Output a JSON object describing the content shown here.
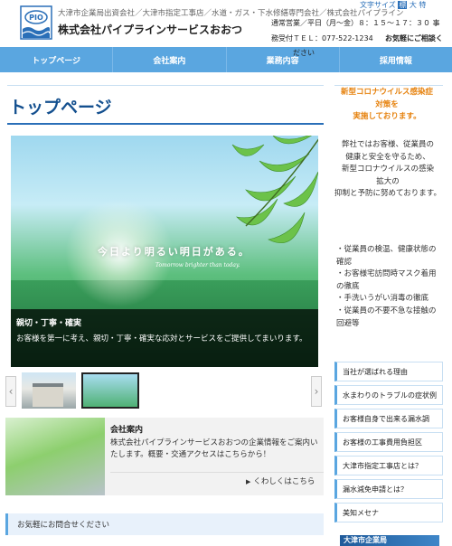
{
  "header": {
    "tagline": "大津市企業局出資会社／大津市指定工事店／水道・ガス・下水修繕専門会社／株式会社パイプライン",
    "company_name": "株式会社パイプラインサービスおおつ",
    "logo_text": "PIO",
    "font_size": {
      "label": "文字サイズ",
      "options": [
        "標",
        "大",
        "特"
      ],
      "selected": "標"
    },
    "hours_line1": "通常営業／平日（月〜金）８：１５〜１７：３０ 事",
    "hours_line2": "務受付ＴＥＬ：077-522-1234",
    "hours_line2b": "ださい",
    "cta": "お気軽にご相談く"
  },
  "nav": {
    "items": [
      "トップページ",
      "会社案内",
      "業務内容",
      "採用情報"
    ]
  },
  "main": {
    "title": "トップページ",
    "hero": {
      "slogan": "今日より明るい明日がある。",
      "slogan_en": "Tomorrow brighter than today.",
      "caption_title": "親切・丁寧・確実",
      "caption_text": "お客様を第一に考え、親切・丁寧・確実な応対とサービスをご提供してまいります。"
    },
    "slider": {
      "prev": "‹",
      "next": "›"
    },
    "info": {
      "title": "会社案内",
      "text": "株式会社パイプラインサービスおおつの企業情報をご案内いたします。概要・交通アクセスはこちらから！",
      "more": "くわしくはこちら"
    },
    "contact_heading": "お気軽にお問合せください"
  },
  "sidebar": {
    "notice_title_1": "新型コロナウイルス感染症",
    "notice_title_2": "対策を",
    "notice_title_3": "実施しております。",
    "notice_body": [
      "弊社ではお客様、従業員の",
      "健康と安全を守るため、",
      "新型コロナウイルスの感染",
      "拡大の",
      "抑制と予防に努めております。"
    ],
    "notice_list": [
      "・従業員の検温、健康状態の確認",
      "・お客様宅訪問時マスク着用の徹底",
      "・手洗いうがい消毒の徹底",
      "・従業員の不要不急な接触の回避等"
    ],
    "links": [
      "当社が選ばれる理由",
      "水まわりのトラブルの症状例",
      "お客様自身で出来る漏水調",
      "お客様の工事費用負担区",
      "大津市指定工事店とは？",
      "漏水減免申請とは？",
      "美知メセナ"
    ],
    "footer_banner": "大津市企業局"
  },
  "colors": {
    "nav_bg": "#5aa6e0",
    "title_blue": "#14508f",
    "notice_orange": "#e6820e"
  }
}
